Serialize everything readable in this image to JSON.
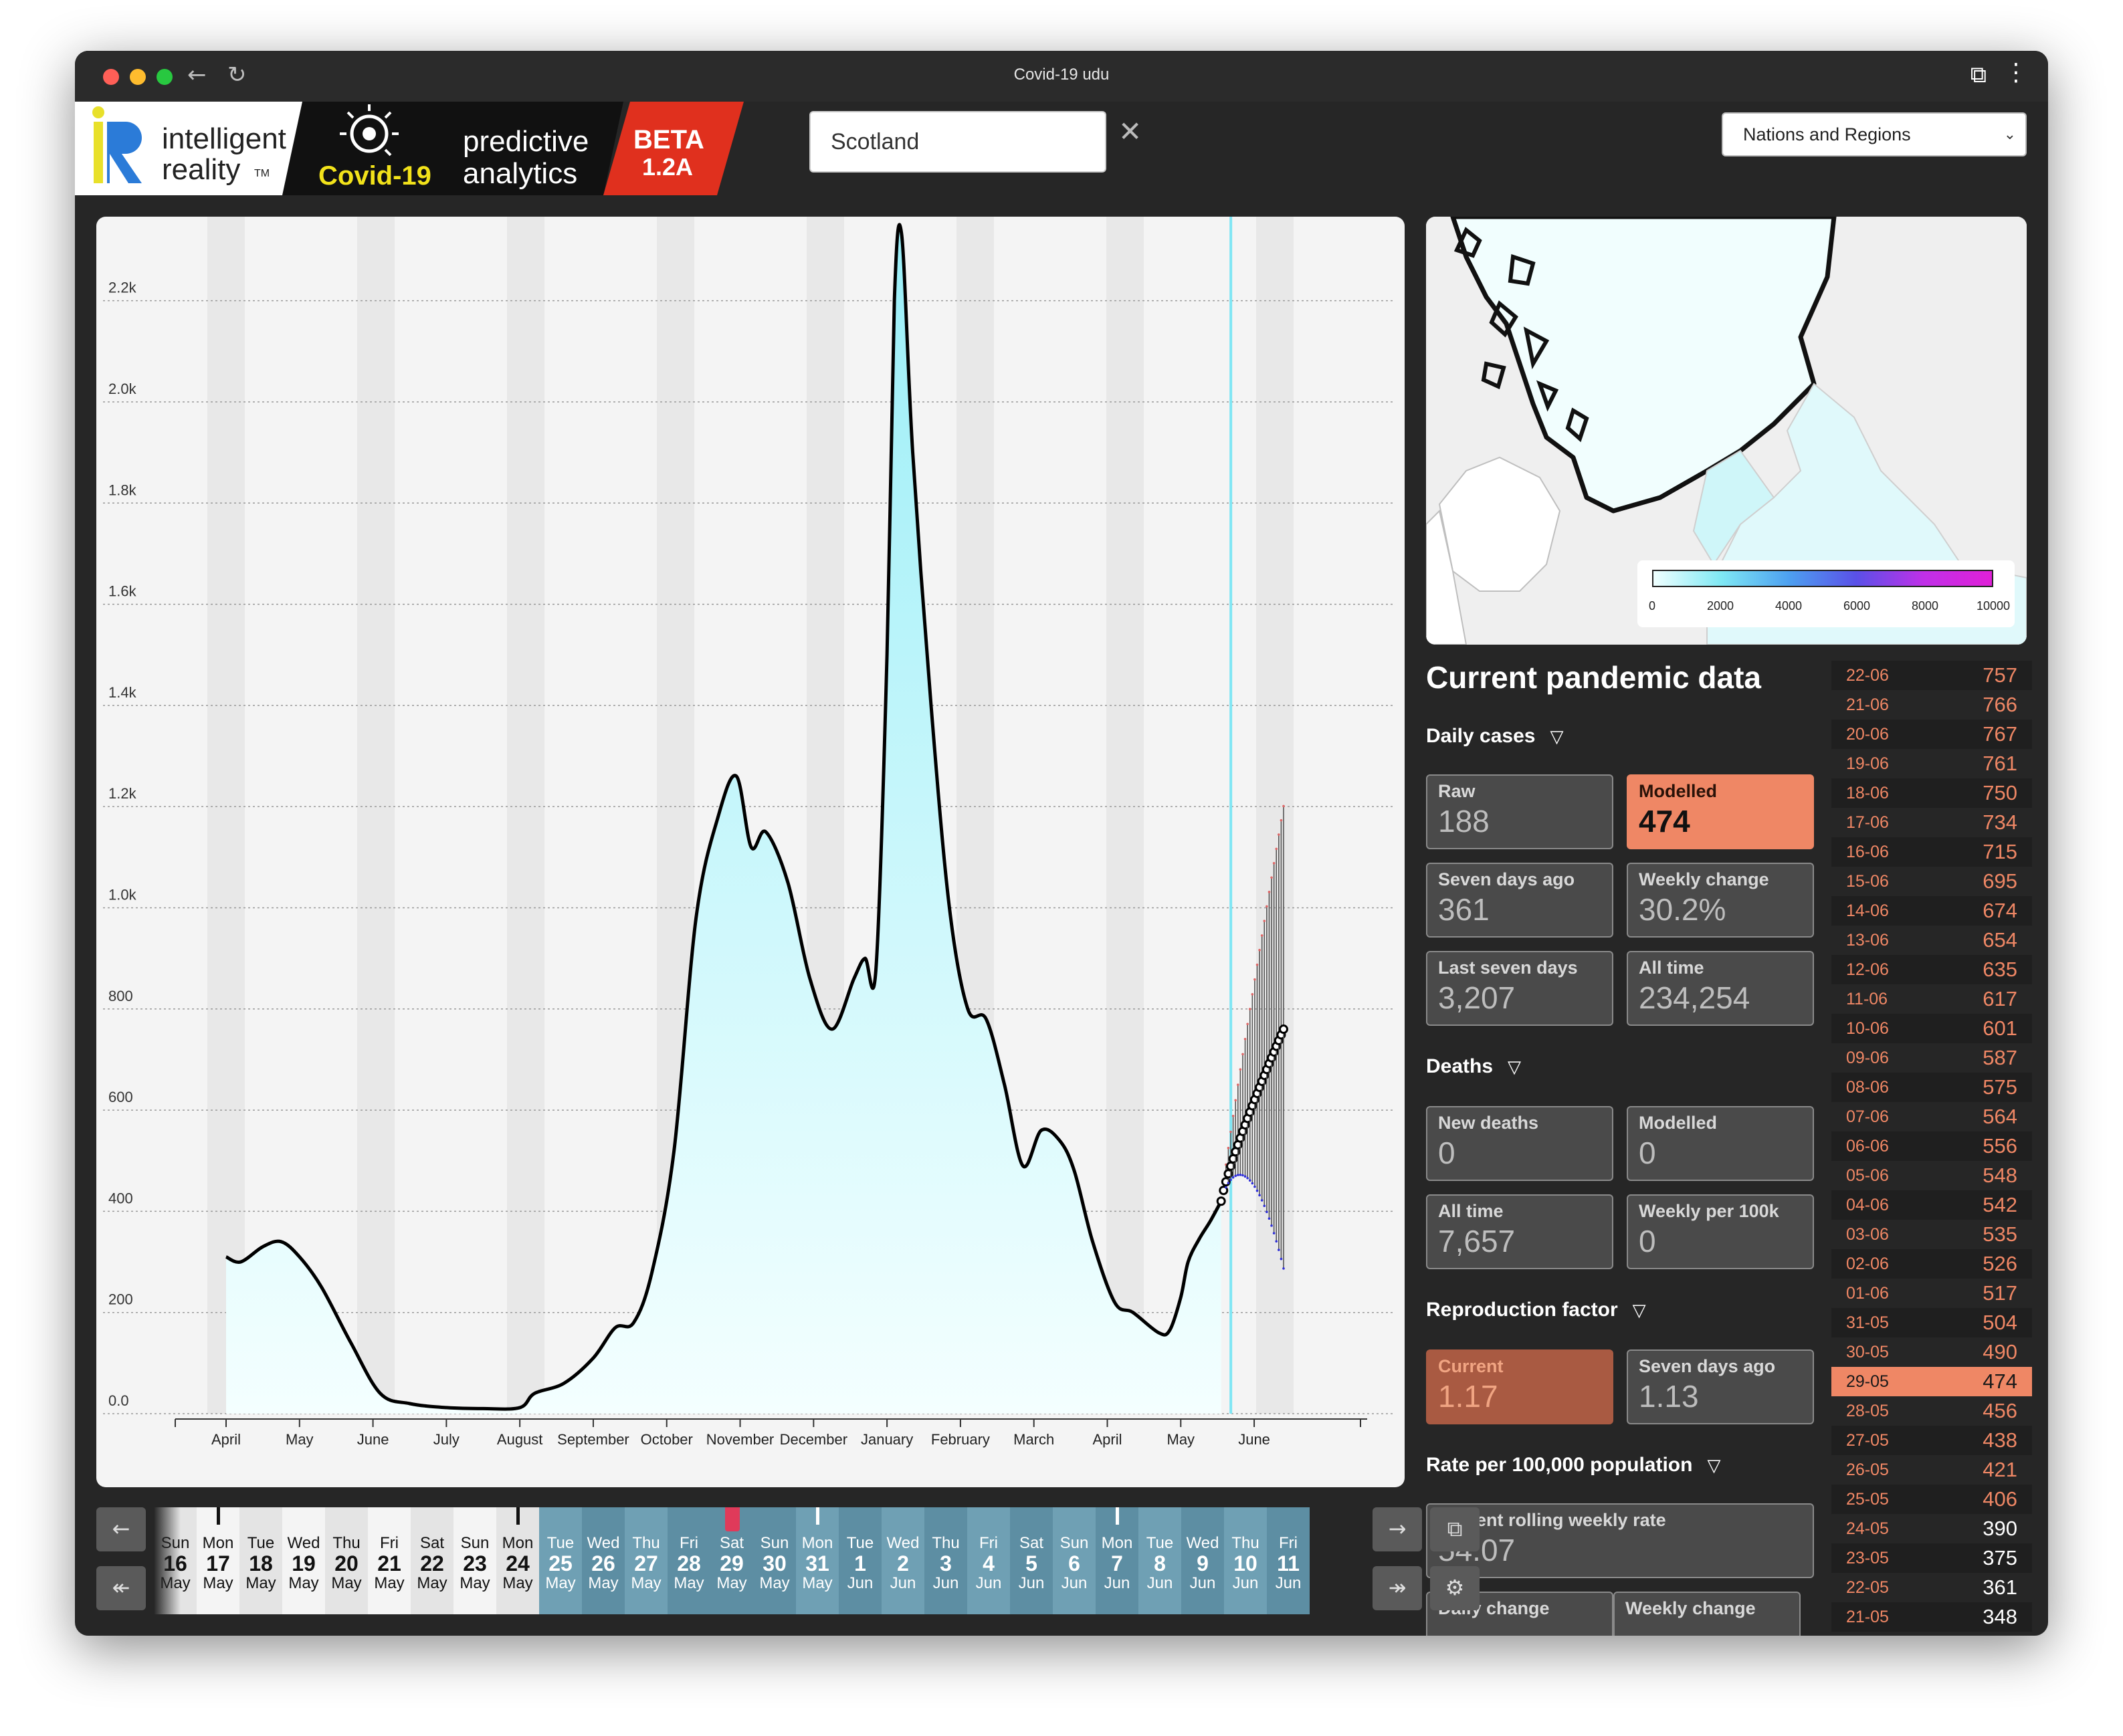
{
  "window": {
    "title": "Covid-19 udu"
  },
  "header": {
    "logo_brand_line1": "intelligent",
    "logo_brand_line2": "reality",
    "logo_tm": "TM",
    "logo_product_line1": "predictive",
    "logo_product_line2": "analytics",
    "logo_covid": "Covid-19",
    "logo_beta": "BETA",
    "logo_version": "1.2A",
    "search_value": "Scotland",
    "region_select": "Nations and Regions"
  },
  "chart_data": {
    "type": "area",
    "y_ticks": [
      "0.0",
      "200",
      "400",
      "600",
      "800",
      "1.0k",
      "1.2k",
      "1.4k",
      "1.6k",
      "1.8k",
      "2.0k",
      "2.2k"
    ],
    "ylim": [
      0,
      2300
    ],
    "x_ticks": [
      "April",
      "May",
      "June",
      "July",
      "August",
      "September",
      "October",
      "November",
      "December",
      "January",
      "February",
      "March",
      "April",
      "May",
      "June"
    ],
    "series": [
      {
        "values_by_month_index": [
          [
            0,
            310
          ],
          [
            0.2,
            300
          ],
          [
            0.5,
            330
          ],
          [
            0.75,
            340
          ],
          [
            1.0,
            310
          ],
          [
            1.3,
            250
          ],
          [
            1.7,
            140
          ],
          [
            2.1,
            40
          ],
          [
            2.5,
            20
          ],
          [
            3.0,
            12
          ],
          [
            3.5,
            10
          ],
          [
            4.0,
            12
          ],
          [
            4.2,
            40
          ],
          [
            4.6,
            60
          ],
          [
            5.0,
            110
          ],
          [
            5.3,
            170
          ],
          [
            5.55,
            180
          ],
          [
            5.8,
            280
          ],
          [
            6.1,
            520
          ],
          [
            6.4,
            980
          ],
          [
            6.7,
            1180
          ],
          [
            6.95,
            1260
          ],
          [
            7.15,
            1120
          ],
          [
            7.35,
            1150
          ],
          [
            7.65,
            1050
          ],
          [
            7.95,
            860
          ],
          [
            8.25,
            760
          ],
          [
            8.55,
            860
          ],
          [
            8.7,
            900
          ],
          [
            8.85,
            880
          ],
          [
            9.0,
            1500
          ],
          [
            9.1,
            2200
          ],
          [
            9.2,
            2330
          ],
          [
            9.35,
            1900
          ],
          [
            9.6,
            1400
          ],
          [
            9.85,
            1000
          ],
          [
            10.1,
            800
          ],
          [
            10.35,
            780
          ],
          [
            10.6,
            650
          ],
          [
            10.85,
            490
          ],
          [
            11.1,
            560
          ],
          [
            11.35,
            540
          ],
          [
            11.55,
            480
          ],
          [
            11.8,
            340
          ],
          [
            12.1,
            220
          ],
          [
            12.35,
            200
          ],
          [
            12.7,
            160
          ],
          [
            12.85,
            165
          ],
          [
            13.0,
            230
          ],
          [
            13.1,
            300
          ],
          [
            13.25,
            345
          ],
          [
            13.4,
            380
          ],
          [
            13.55,
            420
          ]
        ]
      }
    ],
    "forecast": {
      "start_month_index": 13.5,
      "end_month_index": 14.4,
      "median_end": 760,
      "upper_end": 1180,
      "lower_end": 330
    }
  },
  "map": {
    "legend_ticks": [
      "0",
      "2000",
      "4000",
      "6000",
      "8000",
      "10000"
    ]
  },
  "pandemic": {
    "title": "Current pandemic data",
    "daily_cases": {
      "title": "Daily cases",
      "raw_label": "Raw",
      "raw_value": "188",
      "modelled_label": "Modelled",
      "modelled_value": "474",
      "seven_label": "Seven days ago",
      "seven_value": "361",
      "weekly_label": "Weekly change",
      "weekly_value": "30.2%",
      "last7_label": "Last seven days",
      "last7_value": "3,207",
      "alltime_label": "All time",
      "alltime_value": "234,254"
    },
    "deaths": {
      "title": "Deaths",
      "new_label": "New deaths",
      "new_value": "0",
      "modelled_label": "Modelled",
      "modelled_value": "0",
      "alltime_label": "All time",
      "alltime_value": "7,657",
      "weekly100k_label": "Weekly per 100k",
      "weekly100k_value": "0"
    },
    "reproduction": {
      "title": "Reproduction factor",
      "current_label": "Current",
      "current_value": "1.17",
      "seven_label": "Seven days ago",
      "seven_value": "1.13"
    },
    "rate": {
      "title": "Rate per 100,000 population",
      "rolling_label": "Current rolling weekly rate",
      "rolling_value": "54.07",
      "daily_label": "Daily change",
      "weekly_label": "Weekly change"
    }
  },
  "day_list": [
    {
      "date": "22-06",
      "value": "757"
    },
    {
      "date": "21-06",
      "value": "766"
    },
    {
      "date": "20-06",
      "value": "767"
    },
    {
      "date": "19-06",
      "value": "761"
    },
    {
      "date": "18-06",
      "value": "750"
    },
    {
      "date": "17-06",
      "value": "734"
    },
    {
      "date": "16-06",
      "value": "715"
    },
    {
      "date": "15-06",
      "value": "695"
    },
    {
      "date": "14-06",
      "value": "674"
    },
    {
      "date": "13-06",
      "value": "654"
    },
    {
      "date": "12-06",
      "value": "635"
    },
    {
      "date": "11-06",
      "value": "617"
    },
    {
      "date": "10-06",
      "value": "601"
    },
    {
      "date": "09-06",
      "value": "587"
    },
    {
      "date": "08-06",
      "value": "575"
    },
    {
      "date": "07-06",
      "value": "564"
    },
    {
      "date": "06-06",
      "value": "556"
    },
    {
      "date": "05-06",
      "value": "548"
    },
    {
      "date": "04-06",
      "value": "542"
    },
    {
      "date": "03-06",
      "value": "535"
    },
    {
      "date": "02-06",
      "value": "526"
    },
    {
      "date": "01-06",
      "value": "517"
    },
    {
      "date": "31-05",
      "value": "504"
    },
    {
      "date": "30-05",
      "value": "490"
    },
    {
      "date": "29-05",
      "value": "474",
      "selected": true
    },
    {
      "date": "28-05",
      "value": "456"
    },
    {
      "date": "27-05",
      "value": "438"
    },
    {
      "date": "26-05",
      "value": "421"
    },
    {
      "date": "25-05",
      "value": "406"
    },
    {
      "date": "24-05",
      "value": "390",
      "past": true
    },
    {
      "date": "23-05",
      "value": "375",
      "past": true
    },
    {
      "date": "22-05",
      "value": "361",
      "past": true
    },
    {
      "date": "21-05",
      "value": "348",
      "past": true
    }
  ],
  "timeline": {
    "days": [
      {
        "w": "Sun",
        "d": "16",
        "m": "May"
      },
      {
        "w": "Mon",
        "d": "17",
        "m": "May",
        "mark": true
      },
      {
        "w": "Tue",
        "d": "18",
        "m": "May"
      },
      {
        "w": "Wed",
        "d": "19",
        "m": "May"
      },
      {
        "w": "Thu",
        "d": "20",
        "m": "May"
      },
      {
        "w": "Fri",
        "d": "21",
        "m": "May"
      },
      {
        "w": "Sat",
        "d": "22",
        "m": "May"
      },
      {
        "w": "Sun",
        "d": "23",
        "m": "May"
      },
      {
        "w": "Mon",
        "d": "24",
        "m": "May",
        "mark": true
      },
      {
        "w": "Tue",
        "d": "25",
        "m": "May",
        "future": true
      },
      {
        "w": "Wed",
        "d": "26",
        "m": "May",
        "future": true
      },
      {
        "w": "Thu",
        "d": "27",
        "m": "May",
        "future": true
      },
      {
        "w": "Fri",
        "d": "28",
        "m": "May",
        "future": true
      },
      {
        "w": "Sat",
        "d": "29",
        "m": "May",
        "future": true,
        "selected": true
      },
      {
        "w": "Sun",
        "d": "30",
        "m": "May",
        "future": true
      },
      {
        "w": "Mon",
        "d": "31",
        "m": "May",
        "future": true,
        "mark": true
      },
      {
        "w": "Tue",
        "d": "1",
        "m": "Jun",
        "future": true
      },
      {
        "w": "Wed",
        "d": "2",
        "m": "Jun",
        "future": true
      },
      {
        "w": "Thu",
        "d": "3",
        "m": "Jun",
        "future": true
      },
      {
        "w": "Fri",
        "d": "4",
        "m": "Jun",
        "future": true
      },
      {
        "w": "Sat",
        "d": "5",
        "m": "Jun",
        "future": true
      },
      {
        "w": "Sun",
        "d": "6",
        "m": "Jun",
        "future": true
      },
      {
        "w": "Mon",
        "d": "7",
        "m": "Jun",
        "future": true,
        "mark": true
      },
      {
        "w": "Tue",
        "d": "8",
        "m": "Jun",
        "future": true
      },
      {
        "w": "Wed",
        "d": "9",
        "m": "Jun",
        "future": true
      },
      {
        "w": "Thu",
        "d": "10",
        "m": "Jun",
        "future": true
      },
      {
        "w": "Fri",
        "d": "11",
        "m": "Jun",
        "future": true
      }
    ]
  },
  "icons": {
    "back": "arrow-left",
    "reload": "reload",
    "extensions": "puzzle",
    "menu": "more-vertical",
    "clear": "close",
    "prev": "arrow-left",
    "first": "double-arrow-left",
    "next": "arrow-right",
    "last": "double-arrow-right",
    "popout": "popout",
    "settings": "gear"
  },
  "colors": {
    "accent": "#ef8765",
    "area_top": "#9aeef7",
    "area_bottom": "#f4ffff",
    "forecast_line": "#3030d8"
  }
}
